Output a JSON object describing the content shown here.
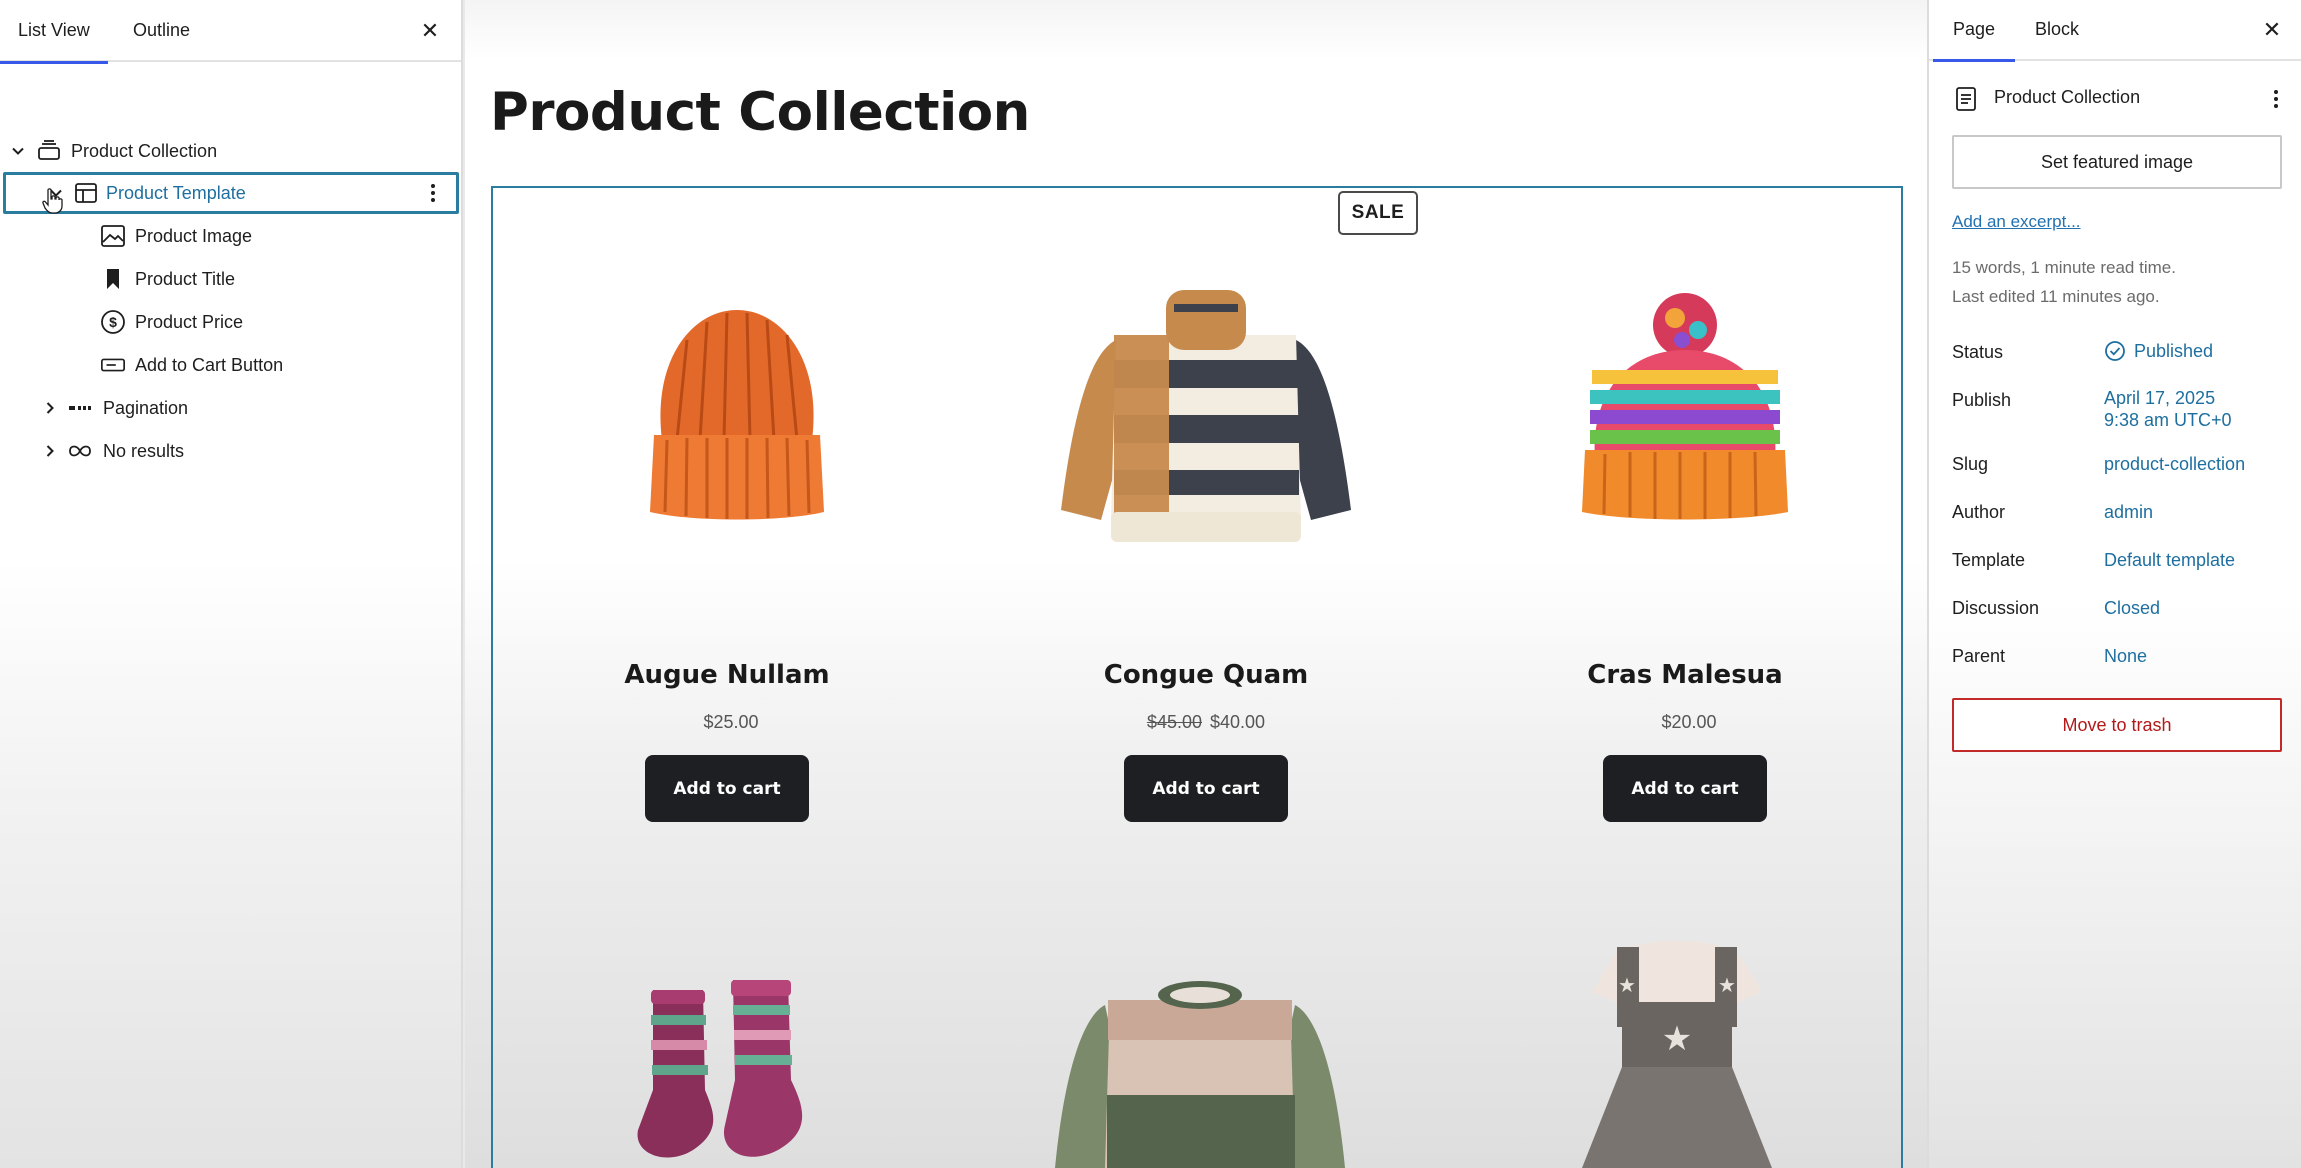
{
  "list_view": {
    "tabs": [
      "List View",
      "Outline"
    ],
    "tree": {
      "product_collection": "Product Collection",
      "product_template": "Product Template",
      "product_image": "Product Image",
      "product_title": "Product Title",
      "product_price": "Product Price",
      "add_to_cart_button": "Add to Cart Button",
      "pagination": "Pagination",
      "no_results": "No results"
    }
  },
  "canvas": {
    "page_title": "Product Collection",
    "sale_badge": "SALE",
    "products": [
      {
        "name": "Augue Nullam",
        "price": "$25.00",
        "old_price": "",
        "button": "Add to cart",
        "image": "orange-beanie"
      },
      {
        "name": "Congue Quam",
        "price": "$40.00",
        "old_price": "$45.00",
        "button": "Add to cart",
        "image": "striped-sweater"
      },
      {
        "name": "Cras Malesua",
        "price": "$20.00",
        "old_price": "",
        "button": "Add to cart",
        "image": "rainbow-pompom-beanie"
      },
      {
        "image": "striped-socks"
      },
      {
        "image": "green-striped-sweater"
      },
      {
        "image": "pinafore-dress"
      }
    ]
  },
  "settings": {
    "tabs": [
      "Page",
      "Block"
    ],
    "title": "Product Collection",
    "featured_image_button": "Set featured image",
    "excerpt_link": "Add an excerpt...",
    "meta_words": "15 words, 1 minute read time.",
    "meta_edited": "Last edited 11 minutes ago.",
    "properties": {
      "status": {
        "label": "Status",
        "value": "Published"
      },
      "publish": {
        "label": "Publish",
        "value_date": "April 17, 2025",
        "value_time": "9:38 am UTC+0"
      },
      "slug": {
        "label": "Slug",
        "value": "product-collection"
      },
      "author": {
        "label": "Author",
        "value": "admin"
      },
      "template": {
        "label": "Template",
        "value": "Default template"
      },
      "discussion": {
        "label": "Discussion",
        "value": "Closed"
      },
      "parent": {
        "label": "Parent",
        "value": "None"
      }
    },
    "trash_button": "Move to trash"
  },
  "colors": {
    "accent": "#3858e9",
    "selection": "#2b7da0",
    "link": "#1e6fa0",
    "danger": "#b21a1a",
    "button_dark": "#1e1f22"
  }
}
